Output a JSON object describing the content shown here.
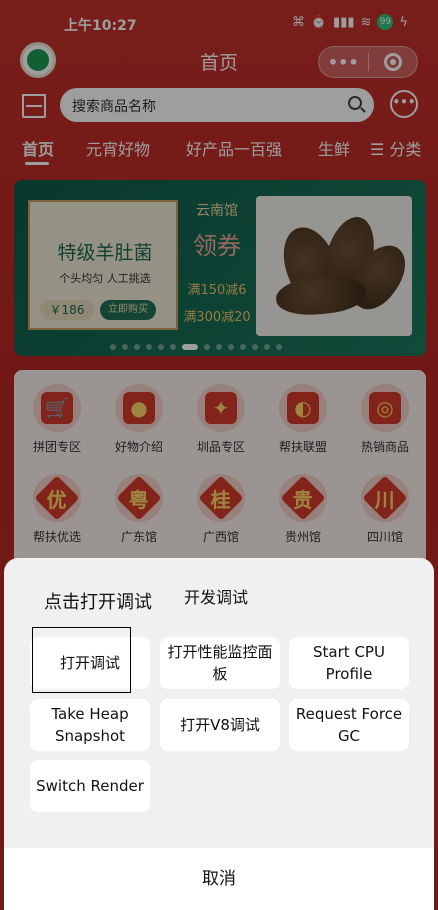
{
  "status_bar": {
    "time": "上午10:27",
    "battery": "99",
    "icons": [
      "screenshot-icon",
      "alarm-icon",
      "signal-icon",
      "wifi-icon",
      "battery-icon",
      "charging-icon"
    ]
  },
  "header": {
    "title": "首页"
  },
  "search": {
    "placeholder": "搜索商品名称"
  },
  "tabs": [
    {
      "label": "首页",
      "active": true
    },
    {
      "label": "元宵好物"
    },
    {
      "label": "好产品一百强"
    },
    {
      "label": "生鲜"
    },
    {
      "label": "☰ 分类"
    }
  ],
  "banner": {
    "title": "特级羊肚菌",
    "subtitle": "个头均匀  人工挑选",
    "price": "￥186",
    "buy_label": "立即购买",
    "store": "云南馆",
    "coupon_title": "领券",
    "offer_1": "满150减6",
    "offer_2": "满300减20"
  },
  "categories": [
    {
      "label": "拼团专区"
    },
    {
      "label": "好物介绍"
    },
    {
      "label": "圳品专区"
    },
    {
      "label": "帮扶联盟"
    },
    {
      "label": "热销商品"
    },
    {
      "label": "帮扶优选",
      "glyph": "优"
    },
    {
      "label": "广东馆",
      "glyph": "粤"
    },
    {
      "label": "广西馆",
      "glyph": "桂"
    },
    {
      "label": "贵州馆",
      "glyph": "贵"
    },
    {
      "label": "四川馆",
      "glyph": "川"
    }
  ],
  "sheet": {
    "hint": "点击打开调试",
    "title": "开发调试",
    "buttons": [
      {
        "label": "打开调试"
      },
      {
        "label": "打开性能监控面板"
      },
      {
        "label": "Start CPU Profile"
      },
      {
        "label": "Take Heap Snapshot"
      },
      {
        "label": "打开V8调试"
      },
      {
        "label": "Request Force GC"
      },
      {
        "label": "Switch Render"
      }
    ],
    "cancel": "取消"
  },
  "colors": {
    "header_red": "#c2302b",
    "banner_green": "#1d7a5f",
    "sheet_bg": "#f0f0f0"
  }
}
